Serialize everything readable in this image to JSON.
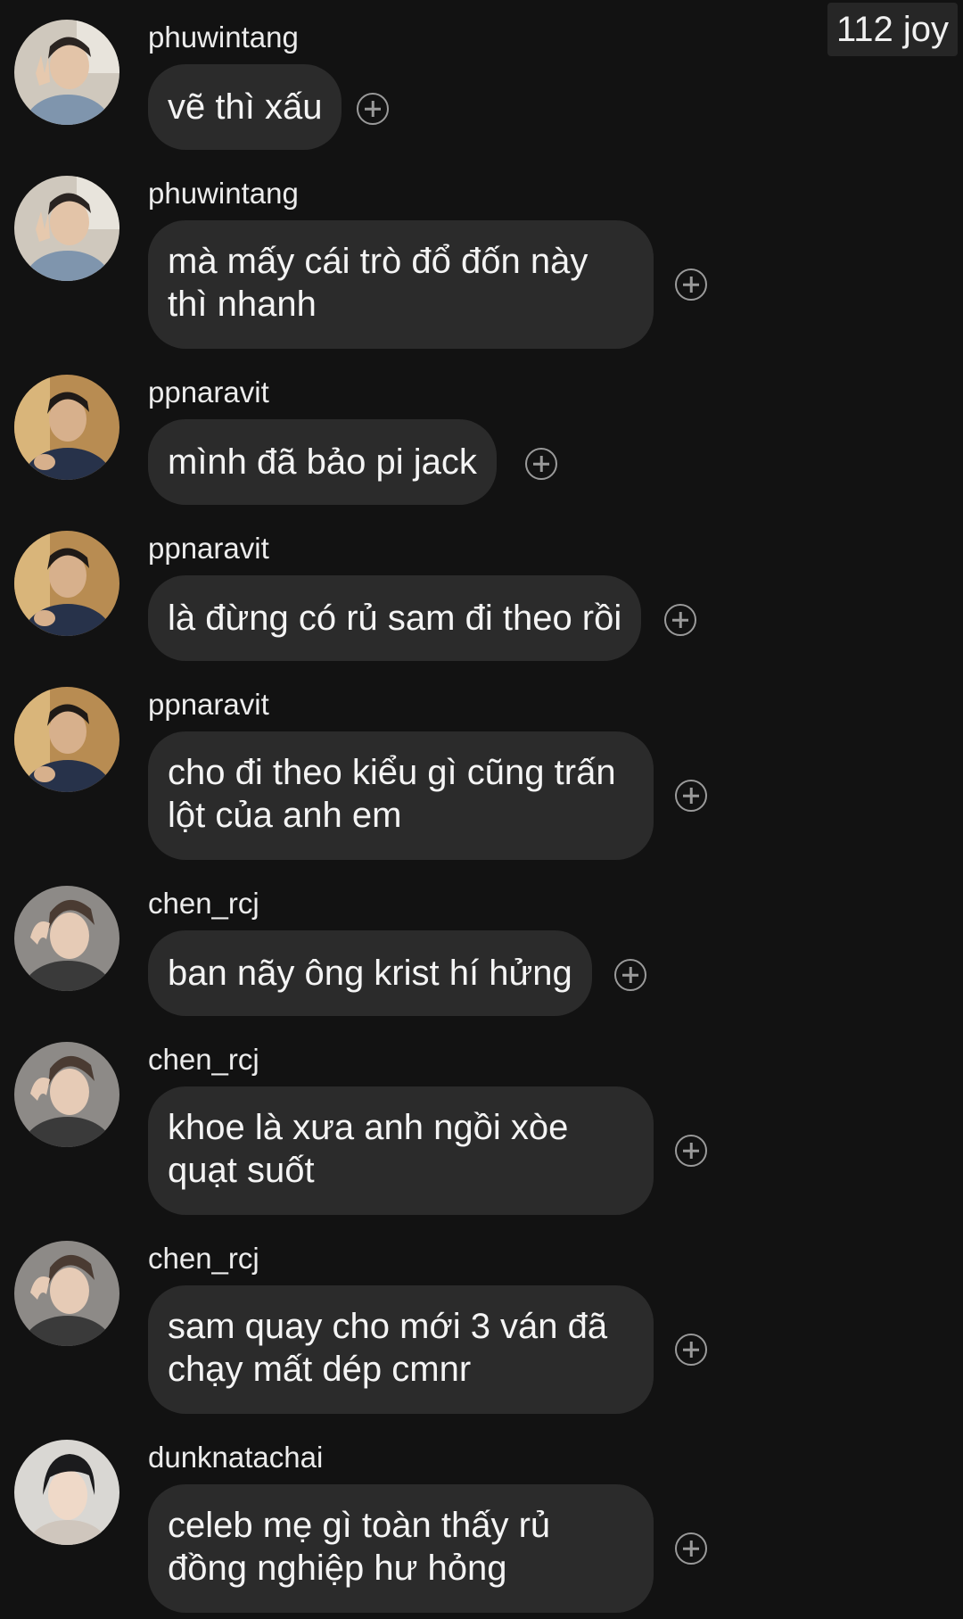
{
  "header": {
    "badge_text": "112 joy"
  },
  "messages": [
    {
      "username": "phuwintang",
      "text": "vẽ thì xấu",
      "avatar": "avatar-phuwintang"
    },
    {
      "username": "phuwintang",
      "text": "mà mấy cái trò đổ đốn này thì nhanh",
      "avatar": "avatar-phuwintang"
    },
    {
      "username": "ppnaravit",
      "text": "mình đã bảo pi jack",
      "avatar": "avatar-ppnaravit"
    },
    {
      "username": "ppnaravit",
      "text": "là đừng có rủ sam đi theo rồi",
      "avatar": "avatar-ppnaravit"
    },
    {
      "username": "ppnaravit",
      "text": "cho đi theo kiểu gì cũng trấn lột của anh em",
      "avatar": "avatar-ppnaravit"
    },
    {
      "username": "chen_rcj",
      "text": "ban nãy ông krist hí hửng",
      "avatar": "avatar-chen_rcj"
    },
    {
      "username": "chen_rcj",
      "text": "khoe là xưa anh ngồi xòe quạt suốt",
      "avatar": "avatar-chen_rcj"
    },
    {
      "username": "chen_rcj",
      "text": "sam quay cho mới 3 ván đã chạy mất dép cmnr",
      "avatar": "avatar-chen_rcj"
    },
    {
      "username": "dunknatachai",
      "text": "celeb mẹ gì toàn thấy rủ đồng nghiệp hư hỏng",
      "avatar": "avatar-dunknatachai"
    }
  ],
  "icons": {
    "add_reaction": "add-reaction-icon"
  },
  "colors": {
    "background": "#121212",
    "bubble": "#2b2b2b",
    "text": "#f4f4f4",
    "icon": "#9a9a9a"
  }
}
